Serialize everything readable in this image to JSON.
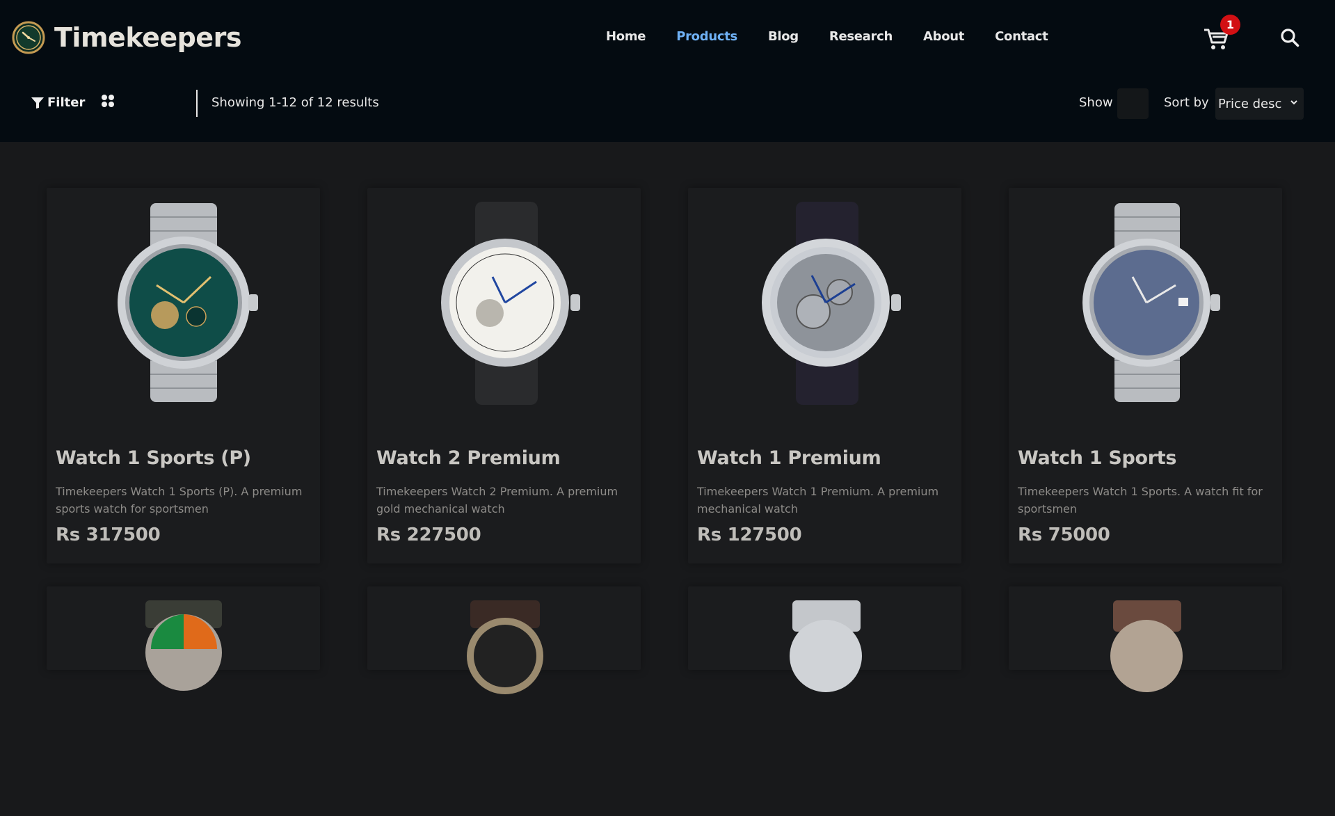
{
  "brand": {
    "name": "Timekeepers"
  },
  "nav": [
    {
      "label": "Home",
      "active": false
    },
    {
      "label": "Products",
      "active": true
    },
    {
      "label": "Blog",
      "active": false
    },
    {
      "label": "Research",
      "active": false
    },
    {
      "label": "About",
      "active": false
    },
    {
      "label": "Contact",
      "active": false
    }
  ],
  "cart": {
    "count": "1",
    "icon": "cart-icon"
  },
  "toolbar": {
    "filter_label": "Filter",
    "results_text": "Showing 1-12 of 12 results",
    "show_label": "Show",
    "sort_label": "Sort by",
    "sort_value": "Price desc"
  },
  "products": [
    {
      "name": "Watch 1 Sports (P)",
      "description": "Timekeepers Watch 1 Sports (P). A premium sports watch for sportsmen",
      "price": "Rs 317500",
      "strap": "steel",
      "dial_color": "#0f4d48"
    },
    {
      "name": "Watch 2 Premium",
      "description": "Timekeepers Watch 2 Premium. A premium gold mechanical watch",
      "price": "Rs 227500",
      "strap": "leather-black",
      "dial_color": "#f2f1ec"
    },
    {
      "name": "Watch 1 Premium",
      "description": "Timekeepers Watch 1 Premium. A premium mechanical watch",
      "price": "Rs 127500",
      "strap": "leather-navy",
      "dial_color": "#c9cdd3"
    },
    {
      "name": "Watch 1 Sports",
      "description": "Timekeepers Watch 1 Sports. A watch fit for sportsmen",
      "price": "Rs 75000",
      "strap": "steel",
      "dial_color": "#5c6c8f"
    }
  ],
  "colors": {
    "header_bg": "#040b11",
    "page_bg": "#18191b",
    "active_nav": "#6fb1f5",
    "badge": "#d21014"
  }
}
